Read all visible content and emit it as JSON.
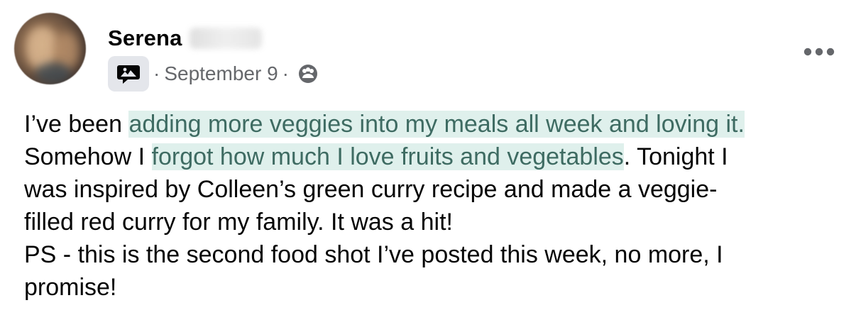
{
  "post": {
    "author": {
      "first_name": "Serena",
      "last_name_redacted": true
    },
    "meta": {
      "group_icon": "group-chat-icon",
      "separator": "·",
      "date": "September 9",
      "audience_icon": "group-audience-icon"
    },
    "more_options_icon": "more-options-icon",
    "highlight_color": "#dff0ec",
    "highlight_text_color": "#3e6b62",
    "body_lines": [
      [
        {
          "text": "I’ve been ",
          "highlight": false
        },
        {
          "text": "adding more veggies into my meals all week and loving it.",
          "highlight": true
        }
      ],
      [
        {
          "text": "Somehow I ",
          "highlight": false
        },
        {
          "text": "forgot how much I love fruits and vegetables",
          "highlight": true
        },
        {
          "text": ". Tonight I",
          "highlight": false
        }
      ],
      [
        {
          "text": "was inspired by Colleen’s green curry recipe and made a veggie-",
          "highlight": false
        }
      ],
      [
        {
          "text": "filled red curry for my family. It was a hit!",
          "highlight": false
        }
      ],
      [
        {
          "text": "PS - this is the second food shot I’ve posted this week, no more, I",
          "highlight": false
        }
      ],
      [
        {
          "text": "promise!",
          "highlight": false
        }
      ]
    ]
  }
}
